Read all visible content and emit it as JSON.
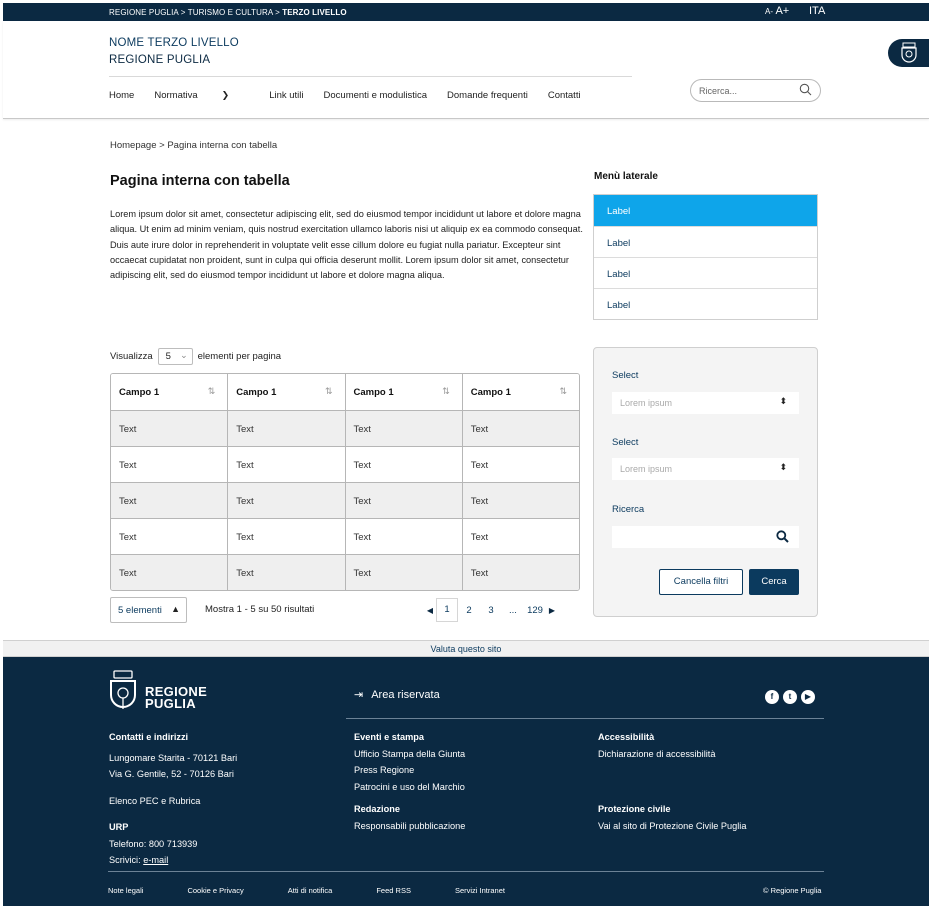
{
  "topbar": {
    "crumb1": "REGIONE PUGLIA",
    "crumb2": "TURISMO E CULTURA",
    "crumb3": "TERZO LIVELLO",
    "font_small": "A-",
    "font_large": "A+",
    "lang": "ITA"
  },
  "header": {
    "site_line1": "NOME TERZO LIVELLO",
    "site_line2": "REGIONE PUGLIA",
    "search_placeholder": "Ricerca...",
    "nav": [
      "Home",
      "Normativa",
      "Link utili",
      "Documenti e modulistica",
      "Domande frequenti",
      "Contatti"
    ]
  },
  "breadcrumb": {
    "home": "Homepage",
    "sep": ">",
    "current": "Pagina interna con tabella"
  },
  "main": {
    "title": "Pagina interna con tabella",
    "intro": "Lorem ipsum dolor sit amet, consectetur adipiscing elit, sed do eiusmod tempor incididunt ut labore et dolore magna aliqua. Ut enim ad minim veniam, quis nostrud exercitation ullamco laboris nisi ut aliquip ex ea commodo consequat. Duis aute irure dolor in reprehenderit in voluptate velit esse cillum dolore eu fugiat nulla pariatur. Excepteur sint occaecat cupidatat non proident, sunt in culpa qui officia deserunt mollit. Lorem ipsum dolor sit amet, consectetur adipiscing elit, sed do eiusmod tempor incididunt ut labore et dolore magna aliqua."
  },
  "side_menu": {
    "title": "Menù laterale",
    "items": [
      "Label",
      "Label",
      "Label",
      "Label"
    ]
  },
  "table": {
    "show_label": "Visualizza",
    "per_page_value": "5",
    "per_page_suffix": "elementi per pagina",
    "headers": [
      "Campo 1",
      "Campo 1",
      "Campo 1",
      "Campo 1"
    ],
    "rows": [
      [
        "Text",
        "Text",
        "Text",
        "Text"
      ],
      [
        "Text",
        "Text",
        "Text",
        "Text"
      ],
      [
        "Text",
        "Text",
        "Text",
        "Text"
      ],
      [
        "Text",
        "Text",
        "Text",
        "Text"
      ],
      [
        "Text",
        "Text",
        "Text",
        "Text"
      ]
    ],
    "pager_select": "5 elementi",
    "results": "Mostra 1 - 5 su 50 risultati",
    "pages": [
      "1",
      "2",
      "3",
      "...",
      "129"
    ],
    "current_page": "1"
  },
  "filter": {
    "select1_label": "Select",
    "select1_placeholder": "Lorem ipsum",
    "select2_label": "Select",
    "select2_placeholder": "Lorem ipsum",
    "search_label": "Ricerca",
    "clear_button": "Cancella filtri",
    "submit_button": "Cerca"
  },
  "rate_bar": "Valuta questo sito",
  "footer": {
    "logo_line1": "REGIONE",
    "logo_line2": "PUGLIA",
    "area_reserved": "Area riservata",
    "col1": {
      "title": "Contatti e indirizzi",
      "addr1": "Lungomare Starita - 70121 Bari",
      "addr2": "Via G. Gentile, 52 - 70126 Bari",
      "pec": "Elenco PEC e Rubrica",
      "urp_title": "URP",
      "phone": "Telefono: 800 713939",
      "write_label": "Scrivici:",
      "email": "e-mail"
    },
    "col2": {
      "title": "Eventi e stampa",
      "links": [
        "Ufficio Stampa della Giunta",
        "Press Regione",
        "Patrocini e uso del Marchio"
      ],
      "title2": "Redazione",
      "link2": "Responsabili pubblicazione"
    },
    "col3": {
      "title": "Accessibilità",
      "link": "Dichiarazione di accessibilità",
      "title2": "Protezione civile",
      "link2": "Vai al sito di Protezione Civile Puglia"
    },
    "bottom_links": [
      "Note legali",
      "Cookie e Privacy",
      "Atti di notifica",
      "Feed RSS",
      "Servizi Intranet"
    ],
    "copyright": "© Regione Puglia"
  },
  "colors": {
    "navy": "#0b2942",
    "accent": "#0ea5ea",
    "link": "#0b3a5e"
  }
}
